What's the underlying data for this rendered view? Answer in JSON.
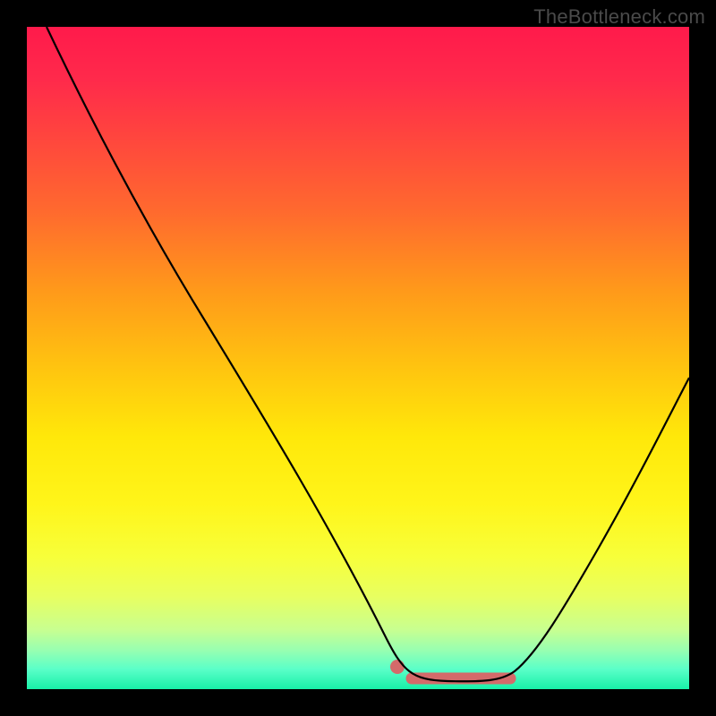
{
  "watermark": "TheBottleneck.com",
  "chart_data": {
    "type": "line",
    "title": "",
    "xlabel": "",
    "ylabel": "",
    "xlim": [
      0,
      100
    ],
    "ylim": [
      0,
      100
    ],
    "background_gradient": {
      "top": "#ff1a4b",
      "mid": "#ffe80a",
      "bottom": "#18f0a8"
    },
    "series": [
      {
        "name": "bottleneck-curve",
        "x": [
          3,
          10,
          20,
          30,
          40,
          50,
          55,
          58,
          60,
          64,
          68,
          72,
          75,
          80,
          85,
          90,
          95,
          100
        ],
        "values": [
          100,
          86,
          70,
          54,
          38,
          22,
          13,
          7,
          3,
          0.5,
          0.5,
          0.5,
          1,
          6,
          14,
          24,
          35,
          47
        ]
      }
    ],
    "annotations": [
      {
        "name": "optimal-range",
        "type": "segment",
        "x_start": 56,
        "x_end": 73,
        "y": 0.5,
        "marker_left": true,
        "color": "#d46a6a"
      }
    ]
  }
}
